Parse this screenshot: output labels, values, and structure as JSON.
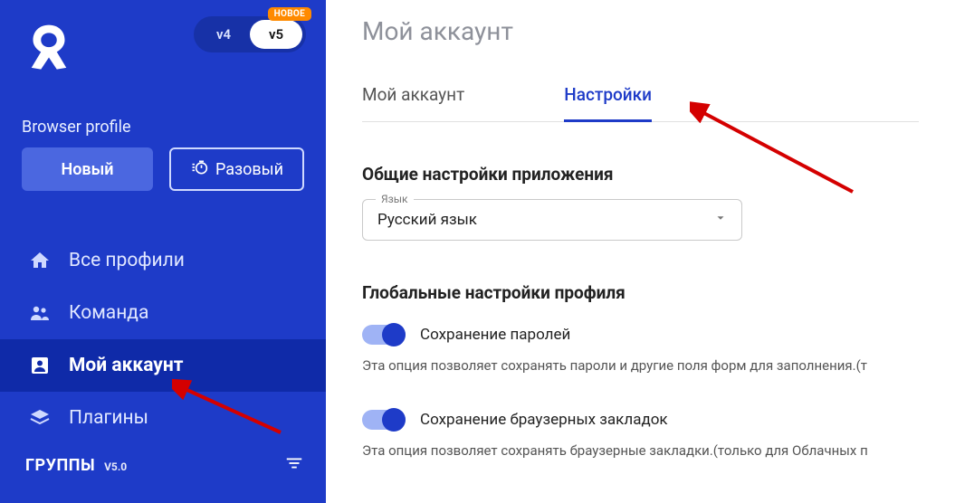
{
  "sidebar": {
    "badge": "НОВОЕ",
    "versions": {
      "v4": "v4",
      "v5": "v5"
    },
    "section_label": "Browser profile",
    "btn_new": "Новый",
    "btn_quick": "Разовый",
    "nav": {
      "all_profiles": "Все профили",
      "team": "Команда",
      "account": "Мой аккаунт",
      "plugins": "Плагины"
    },
    "groups": {
      "title": "ГРУППЫ",
      "version": "V5.0"
    }
  },
  "main": {
    "title": "Мой аккаунт",
    "tabs": {
      "account": "Мой аккаунт",
      "settings": "Настройки"
    },
    "app_settings": {
      "title": "Общие настройки приложения",
      "lang_label": "Язык",
      "lang_value": "Русский язык"
    },
    "profile_settings": {
      "title": "Глобальные настройки профиля",
      "save_passwords": {
        "label": "Сохранение паролей",
        "desc": "Эта опция позволяет сохранять пароли и другие поля форм для заполнения.(т"
      },
      "save_bookmarks": {
        "label": "Сохранение браузерных закладок",
        "desc": "Эта опция позволяет сохранять браузерные закладки.(только для Облачных п"
      }
    }
  }
}
